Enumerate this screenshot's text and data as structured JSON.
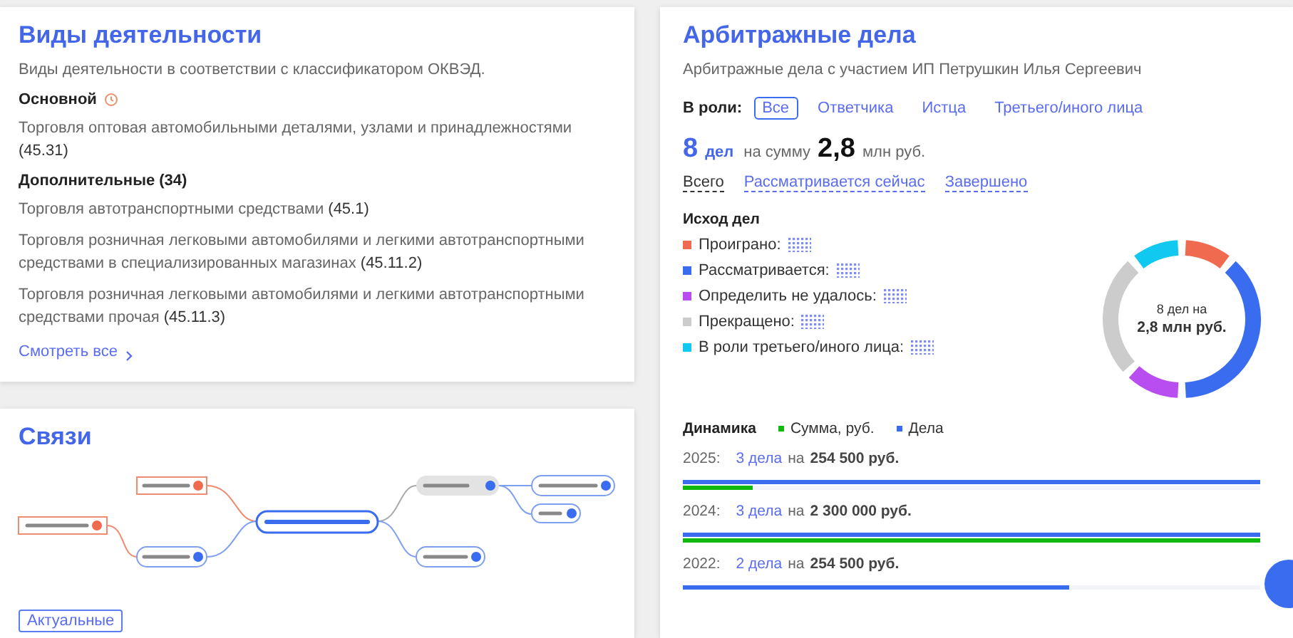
{
  "activities": {
    "title": "Виды деятельности",
    "subtitle": "Виды деятельности в соответствии с классификатором ОКВЭД.",
    "main_label": "Основной",
    "main_items": [
      {
        "name": "Торговля оптовая автомобильными деталями, узлами и принадлежностями",
        "code": "(45.31)"
      }
    ],
    "extra_label": "Дополнительные (34)",
    "extra_items": [
      {
        "name": "Торговля автотранспортными средствами",
        "code": "(45.1)"
      },
      {
        "name": "Торговля розничная легковыми автомобилями и легкими автотранспортными средствами в специализированных магазинах",
        "code": "(45.11.2)"
      },
      {
        "name": "Торговля розничная легковыми автомобилями и легкими автотранспортными средствами прочая",
        "code": "(45.11.3)"
      }
    ],
    "more_link": "Смотреть все"
  },
  "links": {
    "title": "Связи",
    "filter_button": "Актуальные"
  },
  "arbitration": {
    "title": "Арбитражные дела",
    "subtitle": "Арбитражные дела с участием ИП Петрушкин Илья Сергеевич",
    "role_label": "В роли:",
    "roles": [
      {
        "label": "Все",
        "selected": true
      },
      {
        "label": "Ответчика",
        "selected": false
      },
      {
        "label": "Истца",
        "selected": false
      },
      {
        "label": "Третьего/иного лица",
        "selected": false
      }
    ],
    "count": "8",
    "count_unit": "дел",
    "sum_prefix": "на сумму",
    "sum": "2,8",
    "sum_unit": "млн руб.",
    "filters": [
      {
        "label": "Всего",
        "selected": true
      },
      {
        "label": "Рассматривается сейчас",
        "selected": false
      },
      {
        "label": "Завершено",
        "selected": false
      }
    ],
    "outcome": {
      "title": "Исход дел",
      "legend": [
        {
          "label": "Проиграно:",
          "color": "#f06a4f"
        },
        {
          "label": "Рассматривается:",
          "color": "#3a6cf0"
        },
        {
          "label": "Определить не удалось:",
          "color": "#b84ef0"
        },
        {
          "label": "Прекращено:",
          "color": "#cccccc"
        },
        {
          "label": "В роли третьего/иного лица:",
          "color": "#10c8f0"
        }
      ],
      "center_top": "8 дел на",
      "center_bottom": "2,8 млн руб."
    },
    "dynamics": {
      "title": "Динамика",
      "legend": [
        {
          "label": "Сумма, руб.",
          "color": "#10b810"
        },
        {
          "label": "Дела",
          "color": "#3a6cf0"
        }
      ],
      "years": [
        {
          "year": "2025:",
          "cases": "3 дела",
          "mid": "на",
          "amount": "254 500 руб.",
          "cases_bar": {
            "level": 1
          },
          "sum_bar": {
            "level": 0.12
          }
        },
        {
          "year": "2024:",
          "cases": "3 дела",
          "mid": "на",
          "amount": "2 300 000 руб.",
          "cases_bar": {
            "level": 1
          },
          "sum_bar": {
            "level": 1
          }
        },
        {
          "year": "2022:",
          "cases": "2 дела",
          "mid": "на",
          "amount": "254 500 руб.",
          "cases_bar": {
            "level": 0.67
          }
        }
      ]
    }
  }
}
